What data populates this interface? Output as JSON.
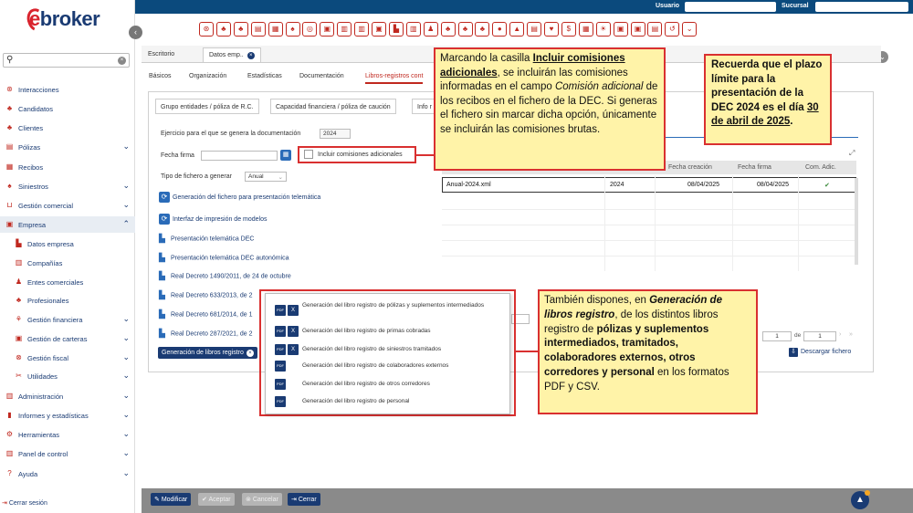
{
  "topbar": {
    "usuario_label": "Usuario",
    "sucursal_label": "Sucursal"
  },
  "brand": {
    "logo_text": "broker",
    "logo_e": "e"
  },
  "sidebar": {
    "search_placeholder": "",
    "items": [
      {
        "label": "Interacciones",
        "icon": "interactions-icon",
        "chevron": ""
      },
      {
        "label": "Candidatos",
        "icon": "candidates-icon",
        "chevron": ""
      },
      {
        "label": "Clientes",
        "icon": "clients-icon",
        "chevron": ""
      },
      {
        "label": "Pólizas",
        "icon": "policies-icon",
        "chevron": "v"
      },
      {
        "label": "Recibos",
        "icon": "receipts-icon",
        "chevron": ""
      },
      {
        "label": "Siniestros",
        "icon": "claims-icon",
        "chevron": "v"
      },
      {
        "label": "Gestión comercial",
        "icon": "cart-icon",
        "chevron": "v"
      },
      {
        "label": "Empresa",
        "icon": "company-icon",
        "chevron": "^"
      },
      {
        "label": "Datos empresa",
        "icon": "company-data-icon",
        "chevron": ""
      },
      {
        "label": "Compañías",
        "icon": "companies-icon",
        "chevron": ""
      },
      {
        "label": "Entes comerciales",
        "icon": "commercial-entities-icon",
        "chevron": ""
      },
      {
        "label": "Profesionales",
        "icon": "professionals-icon",
        "chevron": ""
      },
      {
        "label": "Gestión financiera",
        "icon": "finance-icon",
        "chevron": "v"
      },
      {
        "label": "Gestión de carteras",
        "icon": "portfolio-icon",
        "chevron": "v"
      },
      {
        "label": "Gestión fiscal",
        "icon": "tax-icon",
        "chevron": "v"
      },
      {
        "label": "Utilidades",
        "icon": "tools-icon",
        "chevron": "v"
      },
      {
        "label": "Administración",
        "icon": "admin-icon",
        "chevron": "v"
      },
      {
        "label": "Informes y estadísticas",
        "icon": "reports-icon",
        "chevron": "v"
      },
      {
        "label": "Herramientas",
        "icon": "gear-icon",
        "chevron": "v"
      },
      {
        "label": "Panel de control",
        "icon": "dashboard-icon",
        "chevron": "v"
      },
      {
        "label": "Ayuda",
        "icon": "help-icon",
        "chevron": "v"
      }
    ],
    "logout": "Cerrar sesión"
  },
  "tabs": {
    "escritorio": "Escritorio",
    "datos": "Datos emp.."
  },
  "subtabs": [
    "Básicos",
    "Organización",
    "Estadísticas",
    "Documentación",
    "Libros-registros cont"
  ],
  "inner_tabs": [
    "Grupo entidades / póliza de R.C.",
    "Capacidad financiera / póliza de caución",
    "Info r"
  ],
  "form": {
    "ejercicio_label": "Ejercicio para el que se genera la documentación",
    "ejercicio_value": "2024",
    "fecha_label": "Fecha firma",
    "fecha_value": "",
    "checkbox_label": "Incluir comisiones adicionales",
    "tipo_label": "Tipo de fichero a generar",
    "tipo_value": "Anual"
  },
  "links": [
    "Generación del fichero para presentación telemática",
    "Interfaz de impresión de modelos",
    "Presentación telemática DEC",
    "Presentación telemática DEC autonómica",
    "Real Decreto 1490/2011, de 24 de octubre",
    "Real Decreto 633/2013, de 2",
    "Real Decreto 681/2014, de 1",
    "Real Decreto 287/2021, de 2"
  ],
  "gen_libros_button": "Generación de libros registro",
  "grid": {
    "headers": [
      "Fecha creación",
      "Fecha firma",
      "Com. Adic."
    ],
    "row": {
      "file": "Anual-2024.xml",
      "year": "2024",
      "created": "08/04/2025",
      "signed": "08/04/2025",
      "check": "✔"
    }
  },
  "pager": {
    "page": "1",
    "of": "de",
    "total": "1"
  },
  "download": "Descargar fichero",
  "popup_items": [
    {
      "text": "Generación del libro registro de pólizas y suplementos intermediados",
      "csv": true
    },
    {
      "text": "Generación del libro registro de primas cobradas",
      "csv": true
    },
    {
      "text": "Generación del libro registro de siniestros tramitados",
      "csv": true
    },
    {
      "text": "Generación del libro registro de colaboradores externos",
      "csv": false
    },
    {
      "text": "Generación del libro registro de otros corredores",
      "csv": false
    },
    {
      "text": "Generación del libro registro de personal",
      "csv": false
    }
  ],
  "bottom": {
    "modificar": "Modificar",
    "aceptar": "Aceptar",
    "cancelar": "Cancelar",
    "cerrar": "Cerrar"
  },
  "callouts": {
    "c1_a": "Marcando la casilla ",
    "c1_b": "Incluir comisiones adicionales",
    "c1_c": ", se incluirán las comisiones informadas en el campo ",
    "c1_d": "Comisión adicional",
    "c1_e": " de los recibos en el fichero de la DEC. Si generas el fichero sin marcar dicha opción, únicamente se incluirán las comisiones brutas.",
    "c2_a": "Recuerda que el plazo límite para la presentación de la DEC 2024 es el día ",
    "c2_b": "30 de abril de 2025",
    "c2_c": ".",
    "c3_a": "También dispones, en ",
    "c3_b": "Generación de libros registro",
    "c3_c": ", de los distintos libros registro de ",
    "c3_d": "pólizas y suplementos intermediados, tramitados, colaboradores externos, otros corredores y personal",
    "c3_e": " en los formatos PDF y CSV."
  },
  "colors": {
    "brand_blue": "#1a3b73",
    "brand_red": "#d9232d",
    "callout_bg": "#fff3a8",
    "callout_border": "#d93030"
  }
}
